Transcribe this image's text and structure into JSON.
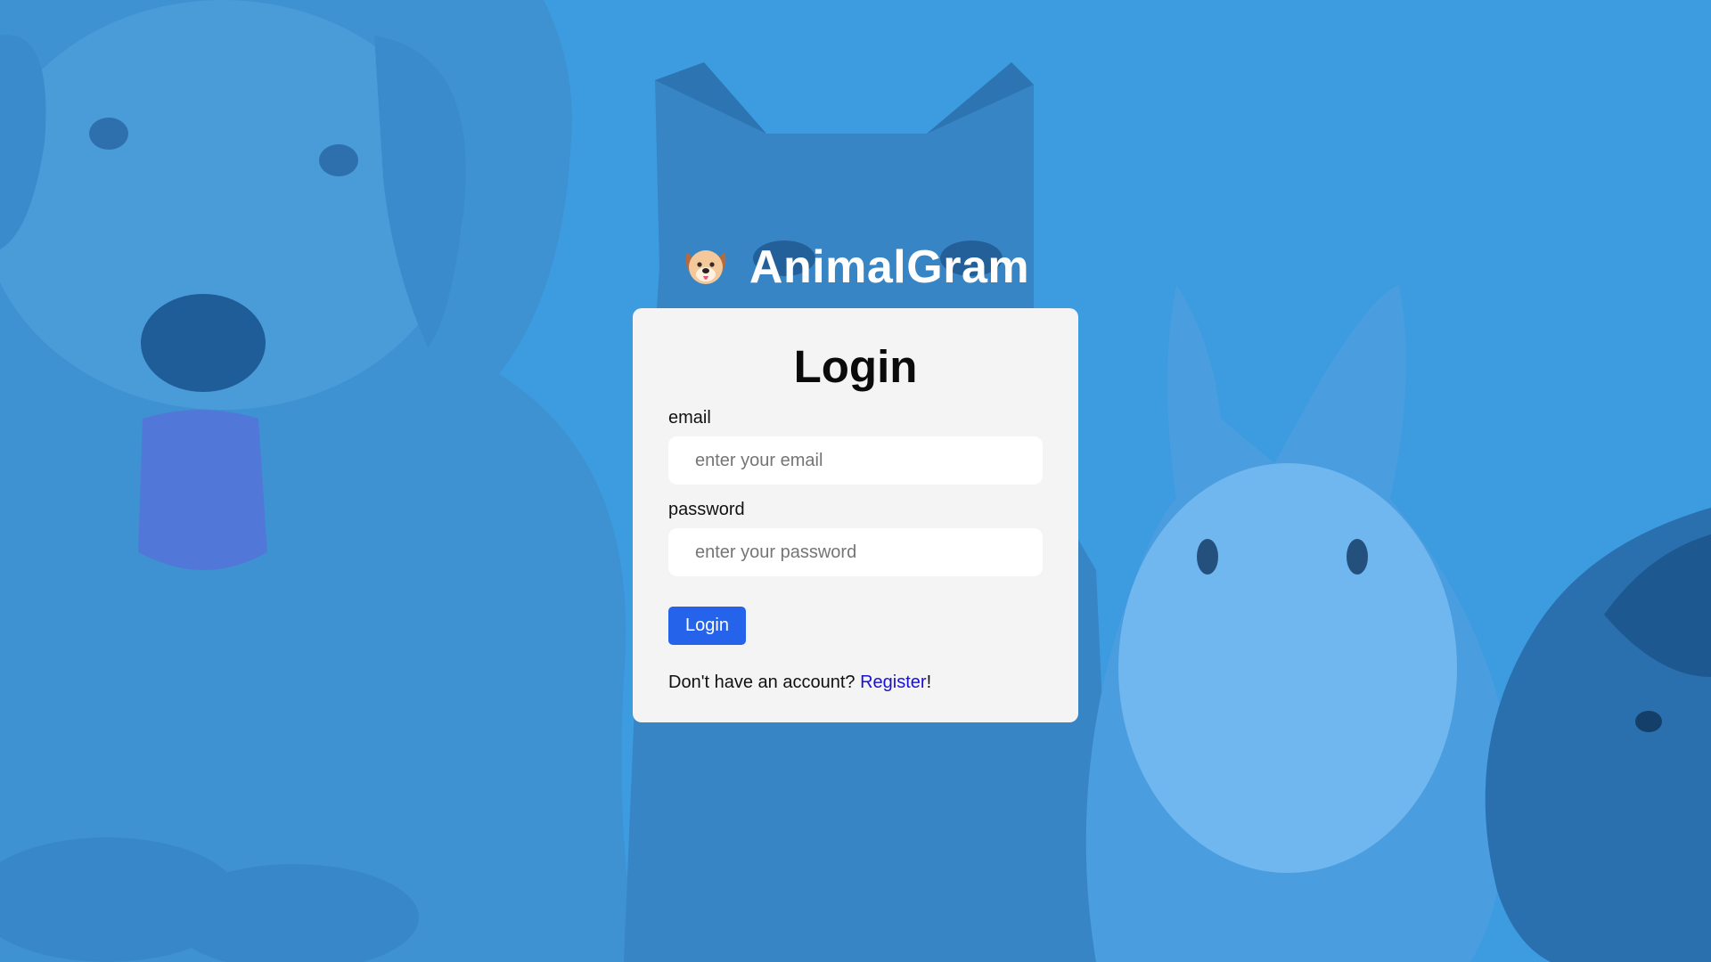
{
  "app": {
    "brand_name": "AnimalGram",
    "brand_icon": "dog-face-emoji"
  },
  "background": {
    "overlay_color": "#3d9be0",
    "subjects": [
      "puppy",
      "kitten",
      "rabbit",
      "guinea-pig"
    ]
  },
  "login_form": {
    "title": "Login",
    "email_label": "email",
    "email_placeholder": "enter your email",
    "email_value": "",
    "password_label": "password",
    "password_placeholder": "enter your password",
    "password_value": "",
    "submit_label": "Login",
    "submit_color": "#2563eb",
    "register_prompt": "Don't have an account? ",
    "register_link": "Register",
    "register_suffix": "!",
    "register_link_color": "#1a0fd6"
  }
}
